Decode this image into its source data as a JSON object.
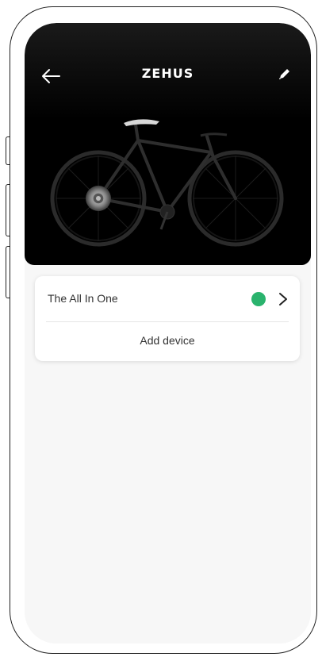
{
  "header": {
    "brand": "ZEHUS",
    "back_icon": "arrow-left-icon",
    "edit_icon": "pencil-icon"
  },
  "hero": {
    "image": "bicycle-image"
  },
  "devices": {
    "items": [
      {
        "name": "The All In One",
        "status_color": "#2ab36d",
        "icon": "chevron-right-icon"
      }
    ],
    "add_label": "Add device"
  },
  "colors": {
    "status_connected": "#2ab36d",
    "hero_background": "#000000",
    "screen_background": "#f7f7f7"
  }
}
